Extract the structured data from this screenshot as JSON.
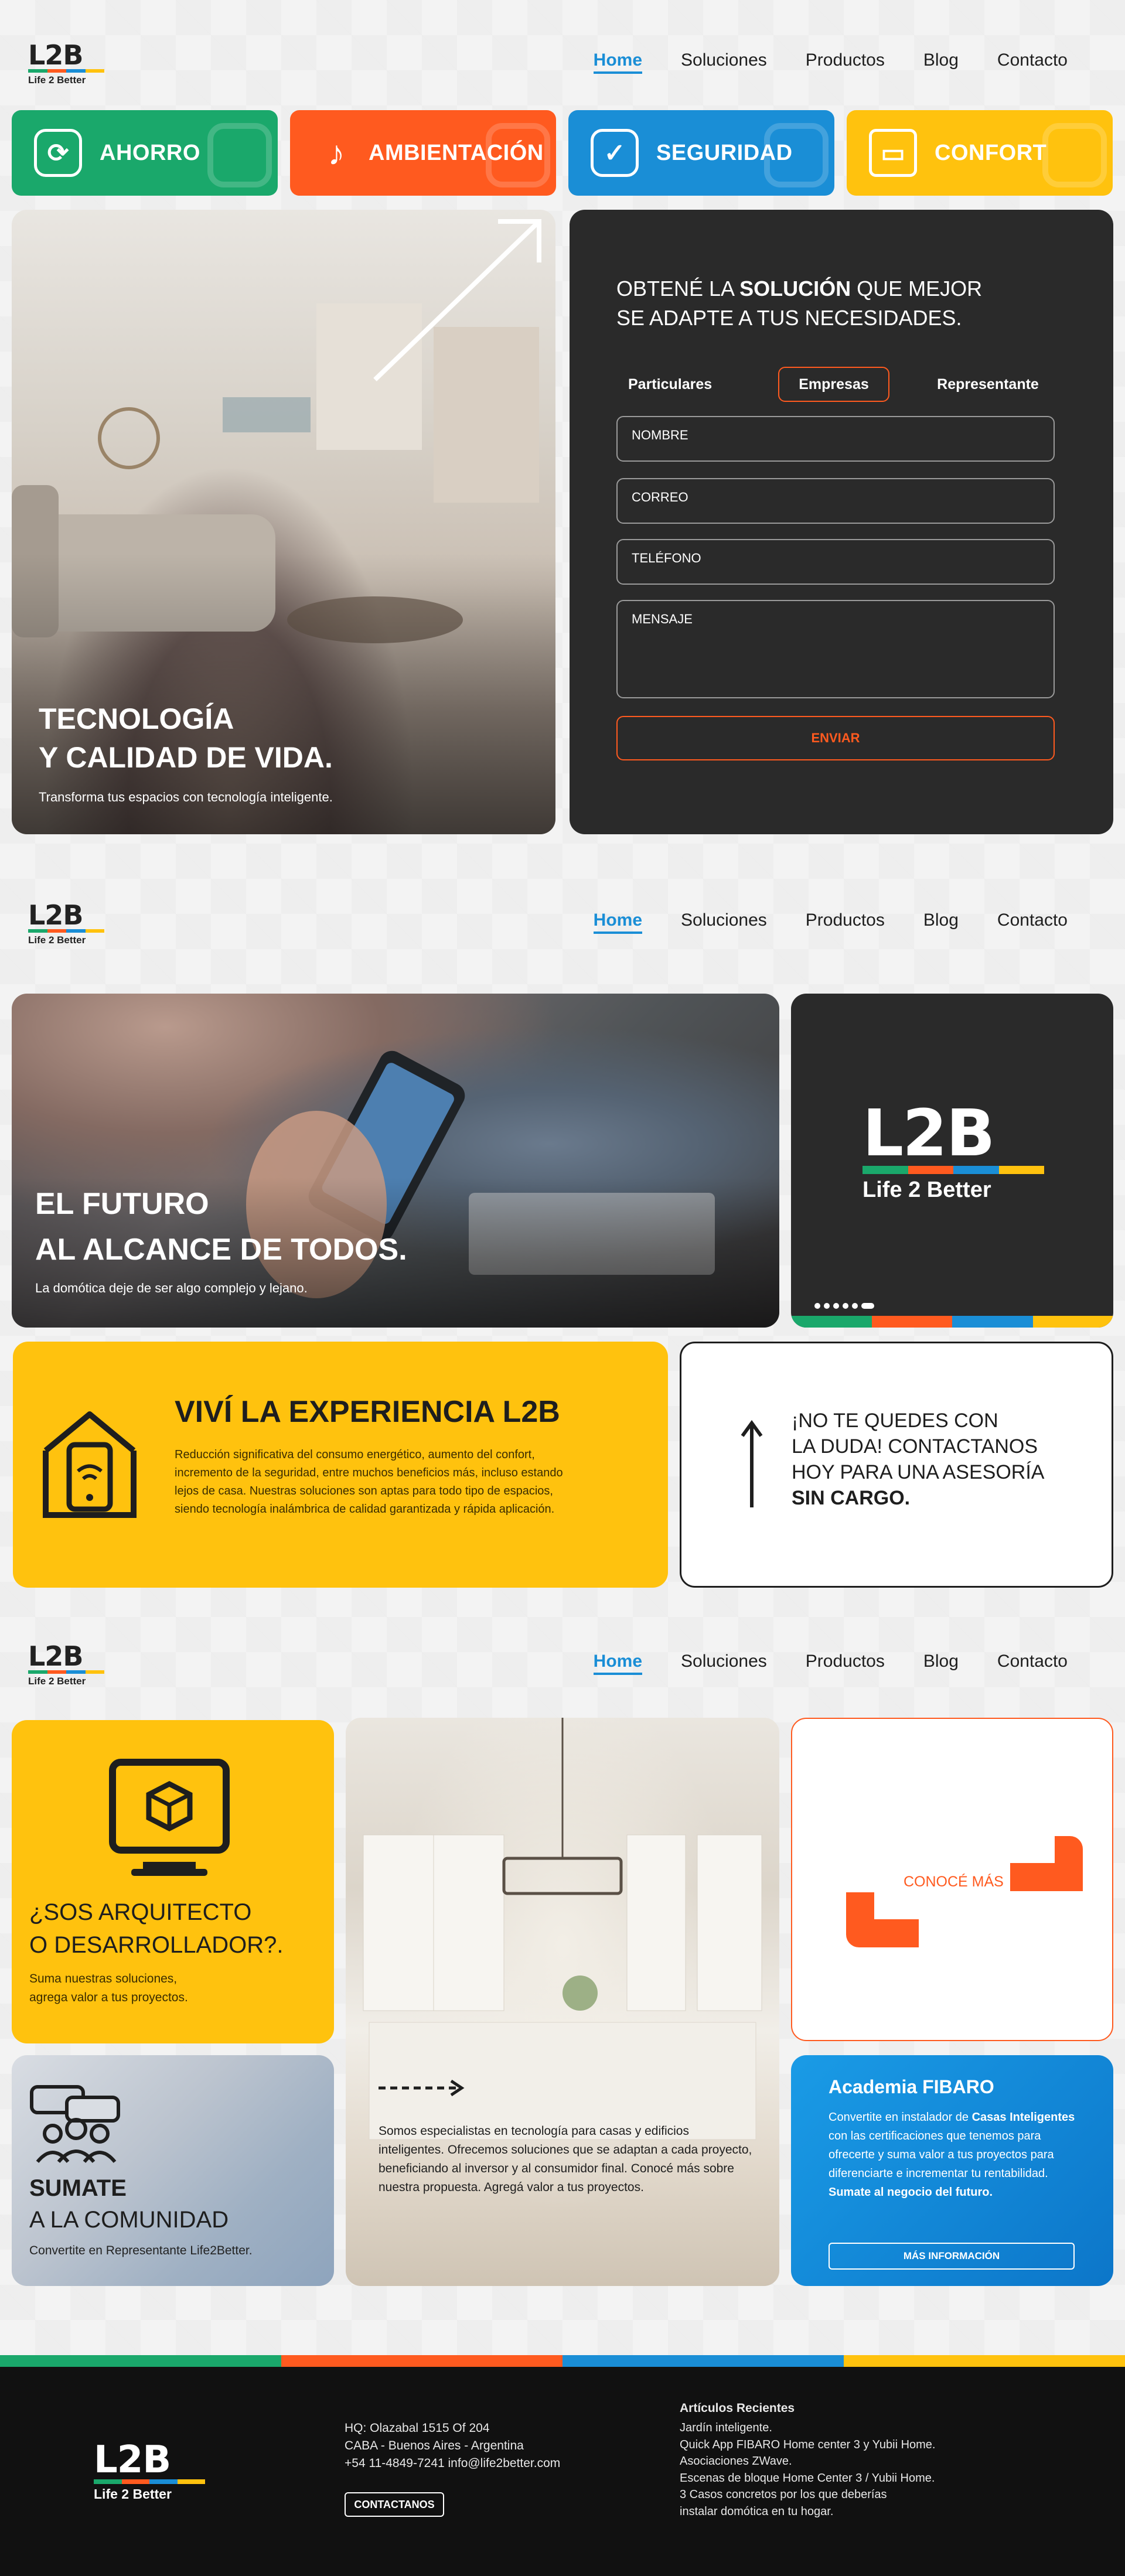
{
  "brand": {
    "mark": "L2B",
    "tagline": "Life 2 Better",
    "colors": [
      "#1aa86b",
      "#ff5a1f",
      "#1a8ed6",
      "#ffc20e"
    ]
  },
  "nav": {
    "items": [
      "Home",
      "Soluciones",
      "Productos",
      "Blog",
      "Contacto"
    ],
    "active": "Home"
  },
  "categories": [
    {
      "label": "AHORRO",
      "color": "#1aa86b",
      "icon": "energy-icon"
    },
    {
      "label": "AMBIENTACIÓN",
      "color": "#ff5a1f",
      "icon": "lamp-icon"
    },
    {
      "label": "SEGURIDAD",
      "color": "#1a8ed6",
      "icon": "shield-home-icon"
    },
    {
      "label": "CONFORT",
      "color": "#ffc20e",
      "icon": "sofa-icon"
    }
  ],
  "hero": {
    "title_line1": "TECNOLOGÍA",
    "title_line2": "Y CALIDAD DE VIDA.",
    "subtitle": "Transforma tus espacios con tecnología inteligente."
  },
  "form": {
    "title_pre": "OBTENÉ LA ",
    "title_bold": "SOLUCIÓN",
    "title_post": " QUE MEJOR",
    "title_line2": "SE ADAPTE A TUS NECESIDADES.",
    "tabs": [
      "Particulares",
      "Empresas",
      "Representante"
    ],
    "active_tab": "Empresas",
    "fields": [
      "NOMBRE",
      "CORREO",
      "TELÉFONO",
      "MENSAJE"
    ],
    "submit": "ENVIAR"
  },
  "future": {
    "title_line1": "EL FUTURO",
    "title_line2": "AL ALCANCE DE TODOS.",
    "subtitle": "La domótica deje de ser algo complejo y lejano."
  },
  "experience": {
    "title": "VIVÍ LA EXPERIENCIA L2B",
    "body": "Reducción significativa del consumo energético, aumento del confort, incremento de la seguridad, entre muchos beneficios más, incluso estando lejos de casa. Nuestras soluciones son aptas para todo tipo de espacios, siendo tecnología inalámbrica de calidad garantizada y rápida aplicación."
  },
  "contact_cta": {
    "line1": "¡NO TE QUEDES CON",
    "line2": "LA DUDA! CONTACTANOS",
    "line3": "HOY PARA UNA ASESORÍA",
    "line4": "SIN CARGO."
  },
  "architect": {
    "title_line1": "¿SOS ARQUITECTO",
    "title_line2": "O DESARROLLADOR?.",
    "body_line1": "Suma nuestras soluciones,",
    "body_line2": "agrega valor a tus proyectos."
  },
  "conoce": {
    "label": "CONOCÉ MÁS"
  },
  "community": {
    "title_bold": "SUMATE",
    "title_line2": "A LA COMUNIDAD",
    "body": "Convertite en Representante Life2Better."
  },
  "specialists": {
    "body": "Somos especialistas en tecnología para casas y edificios inteligentes. Ofrecemos soluciones que se adaptan a cada proyecto, beneficiando al inversor y al consumidor final. Conocé más sobre nuestra propuesta. Agregá valor a tus proyectos."
  },
  "academy": {
    "title": "Academia FIBARO",
    "body_pre": "Convertite en instalador de ",
    "body_bold": "Casas Inteligentes",
    "body_post": " con las certificaciones que tenemos para ofrecerte y suma valor a tus proyectos para diferenciarte e incrementar tu rentabilidad.",
    "tagline": "Sumate al negocio del futuro.",
    "button": "MÁS INFORMACIÓN"
  },
  "footer": {
    "address_line1": "HQ: Olazabal 1515 Of 204",
    "address_line2": "CABA - Buenos Aires - Argentina",
    "address_line3": "+54 11-4849-7241 info@life2better.com",
    "contact_button": "CONTACTANOS",
    "recent_title": "Artículos Recientes",
    "recent": [
      "Jardín inteligente.",
      "Quick App FIBARO Home center 3 y Yubii Home.",
      "Asociaciones ZWave.",
      "Escenas de bloque Home Center 3 / Yubii Home.",
      "3 Casos concretos por los que deberías",
      "instalar domótica en tu hogar."
    ]
  }
}
